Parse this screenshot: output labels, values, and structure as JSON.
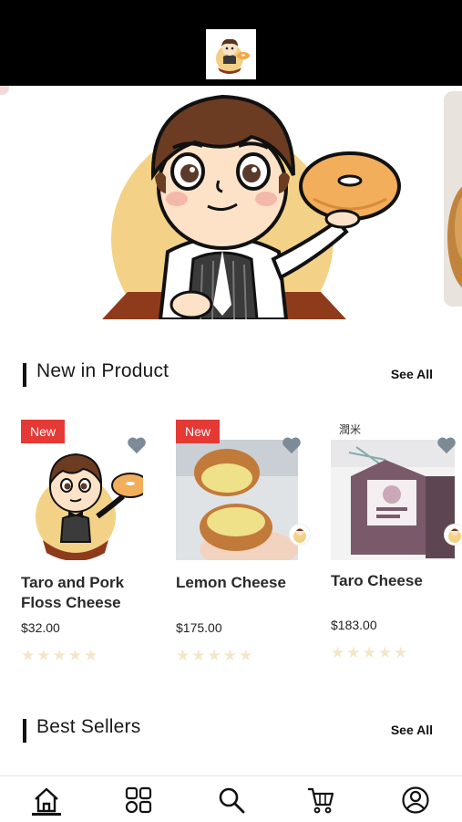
{
  "header": {
    "logo_icon": "food-hunter-logo-icon"
  },
  "banner": {
    "image": "mascot-holding-donut-banner"
  },
  "sections": {
    "new_in_product": {
      "title": "New in Product",
      "see_all": "See All"
    },
    "best_sellers": {
      "title": "Best Sellers",
      "see_all": "See All"
    }
  },
  "products": [
    {
      "badge": "New",
      "title": "Taro and Pork Floss Cheese",
      "price": "$32.00",
      "rating": 0,
      "max_rating": 5
    },
    {
      "badge": "New",
      "title": "Lemon Cheese",
      "price": "$175.00",
      "rating": 0,
      "max_rating": 5
    },
    {
      "badge": "",
      "title": "Taro Cheese",
      "price": "$183.00",
      "rating": 0,
      "max_rating": 5,
      "image_caption": "潤米"
    }
  ],
  "bottom_nav": [
    {
      "name": "home-icon",
      "active": true
    },
    {
      "name": "categories-icon",
      "active": false
    },
    {
      "name": "search-icon",
      "active": false
    },
    {
      "name": "cart-icon",
      "active": false
    },
    {
      "name": "profile-icon",
      "active": false
    }
  ],
  "colors": {
    "accent_red": "#e53935",
    "heart": "#7d8b99",
    "star_empty": "#f5e6c8",
    "topbar": "#000000"
  }
}
